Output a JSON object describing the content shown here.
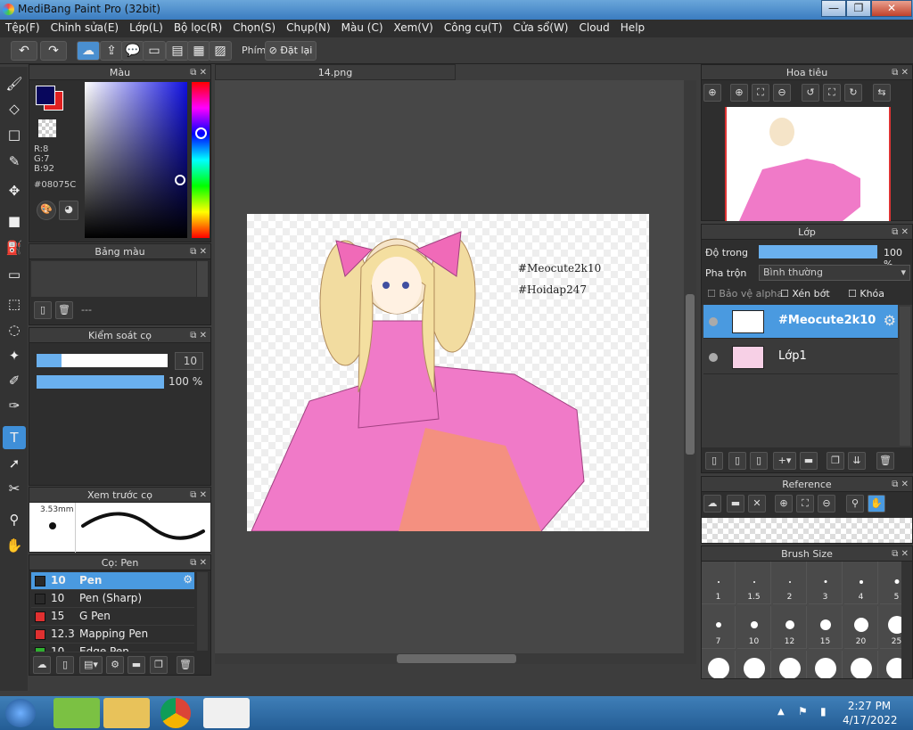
{
  "window": {
    "title": "MediBang Paint Pro (32bit)",
    "minimize": "—",
    "maximize": "❐",
    "close": "✕"
  },
  "menu": [
    "Tệp(F)",
    "Chỉnh sửa(E)",
    "Lớp(L)",
    "Bộ lọc(R)",
    "Chọn(S)",
    "Chụp(N)",
    "Màu (C)",
    "Xem(V)",
    "Công cụ(T)",
    "Cửa sổ(W)",
    "Cloud",
    "Help"
  ],
  "toolbar": {
    "shortcut_label": "Phím",
    "reset_label": "Đặt lại"
  },
  "color_panel": {
    "title": "Màu",
    "r": "R:8",
    "g": "G:7",
    "b": "B:92",
    "hex": "#08075C",
    "primary_color": "#08075C",
    "secondary_color": "#e02020"
  },
  "palette_panel": {
    "title": "Bảng màu",
    "empty": "---"
  },
  "brush_control": {
    "title": "Kiểm soát cọ",
    "size": "10",
    "opacity": "100 %",
    "opacity_value": 1.0
  },
  "brush_preview": {
    "title": "Xem trước cọ",
    "size": "3.53mm"
  },
  "brush_list": {
    "title": "Cọ: Pen",
    "items": [
      {
        "size": "10",
        "name": "Pen",
        "color": "#2a2a2a",
        "selected": true
      },
      {
        "size": "10",
        "name": "Pen (Sharp)",
        "color": "#2a2a2a"
      },
      {
        "size": "15",
        "name": "G Pen",
        "color": "#e03030"
      },
      {
        "size": "12.3",
        "name": "Mapping Pen",
        "color": "#e03030"
      },
      {
        "size": "10",
        "name": "Edge Pen",
        "color": "#30b030"
      }
    ]
  },
  "canvas": {
    "tab": "14.png",
    "text1": "#Meocute2k10",
    "text2": "#Hoidap247"
  },
  "navigator": {
    "title": "Hoa tiêu"
  },
  "layers": {
    "title": "Lớp",
    "opacity_label": "Độ trong",
    "opacity_value": "100 %",
    "blend_label": "Pha trộn",
    "blend_value": "Bình thường",
    "protect_alpha": "Bảo vệ alpha",
    "clipping": "Xén bớt",
    "lock": "Khóa",
    "items": [
      {
        "name": "#Meocute2k10",
        "selected": true
      },
      {
        "name": "Lớp1"
      }
    ]
  },
  "reference": {
    "title": "Reference"
  },
  "brush_size": {
    "title": "Brush Size",
    "rows": [
      [
        "1",
        "1.5",
        "2",
        "3",
        "4",
        "5"
      ],
      [
        "7",
        "10",
        "12",
        "15",
        "20",
        "25"
      ],
      [
        "",
        "",
        "",
        "",
        "",
        ""
      ]
    ]
  },
  "taskbar": {
    "time": "2:27 PM",
    "date": "4/17/2022"
  }
}
